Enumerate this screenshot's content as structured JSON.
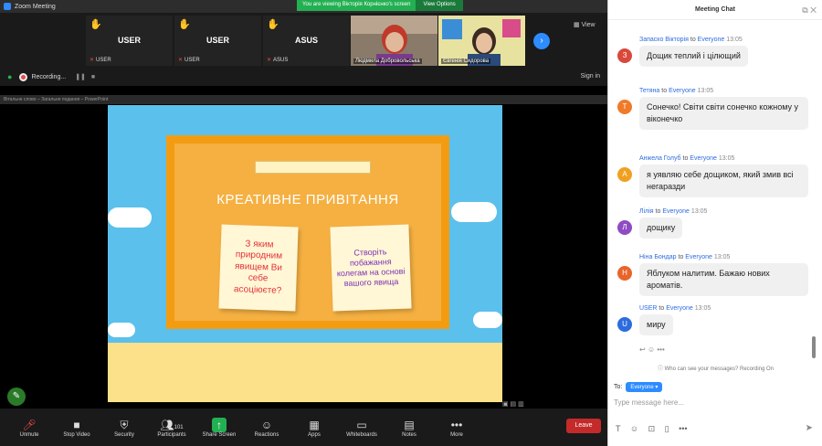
{
  "window": {
    "title": "Zoom Meeting"
  },
  "share_banner": {
    "viewing": "You are viewing Вікторія Корнієнко's screen",
    "view_options": "View Options"
  },
  "gallery": {
    "tiles": [
      {
        "label": "USER",
        "name": "USER"
      },
      {
        "label": "USER",
        "name": "USER"
      },
      {
        "label": "ASUS",
        "name": "ASUS"
      }
    ],
    "videos": [
      {
        "name": "Людмила Добровольська"
      },
      {
        "name": "Євгенія Сидорова"
      }
    ],
    "view_label": "View"
  },
  "status_bar": {
    "recording": "Recording...",
    "sign_in": "Sign in"
  },
  "ppt": {
    "title": "Вітальне слово – Загальне подання – PowerPoint"
  },
  "slide": {
    "heading": "КРЕАТИВНЕ ПРИВІТАННЯ",
    "note1": "З яким природним явищем Ви себе асоціюєте?",
    "note2": "Створіть побажання колегам на основі вашого явища"
  },
  "toolbar": {
    "unmute": "Unmute",
    "stop_video": "Stop Video",
    "security": "Security",
    "participants": "Participants",
    "participants_count": "101",
    "share_screen": "Share Screen",
    "reactions": "Reactions",
    "apps": "Apps",
    "whiteboards": "Whiteboards",
    "notes": "Notes",
    "more": "More",
    "leave": "Leave"
  },
  "chat": {
    "title": "Meeting Chat",
    "messages": [
      {
        "sender": "Запаско Вікторія",
        "to": "to",
        "recipient": "Everyone",
        "time": "13:05",
        "text": "Дощик теплий і цілющий",
        "initial": "З",
        "color": "#d9483b"
      },
      {
        "sender": "Тетяна",
        "to": "to",
        "recipient": "Everyone",
        "time": "13:05",
        "text": "Сонечко! Світи світи сонечко кожному у віконечко",
        "initial": "Т",
        "color": "#f07a2a"
      },
      {
        "sender": "Анжела Голуб",
        "to": "to",
        "recipient": "Everyone",
        "time": "13:05",
        "text": "я уявляю себе дощиком, який змив всі негаразди",
        "initial": "А",
        "color": "#f0a020"
      },
      {
        "sender": "Лілія",
        "to": "to",
        "recipient": "Everyone",
        "time": "13:05",
        "text": "дощику",
        "initial": "Л",
        "color": "#8e4bc4"
      },
      {
        "sender": "Ніна Бондар",
        "to": "to",
        "recipient": "Everyone",
        "time": "13:05",
        "text": "Яблуком налитим. Бажаю нових ароматів.",
        "initial": "Н",
        "color": "#e8642a"
      },
      {
        "sender": "USER",
        "to": "to",
        "recipient": "Everyone",
        "time": "13:05",
        "text": "миру",
        "initial": "U",
        "color": "#2d6cdf"
      }
    ],
    "privacy": "Who can see your messages? Recording On",
    "to_label": "To:",
    "recipient_pill": "Everyone",
    "placeholder": "Type message here..."
  }
}
